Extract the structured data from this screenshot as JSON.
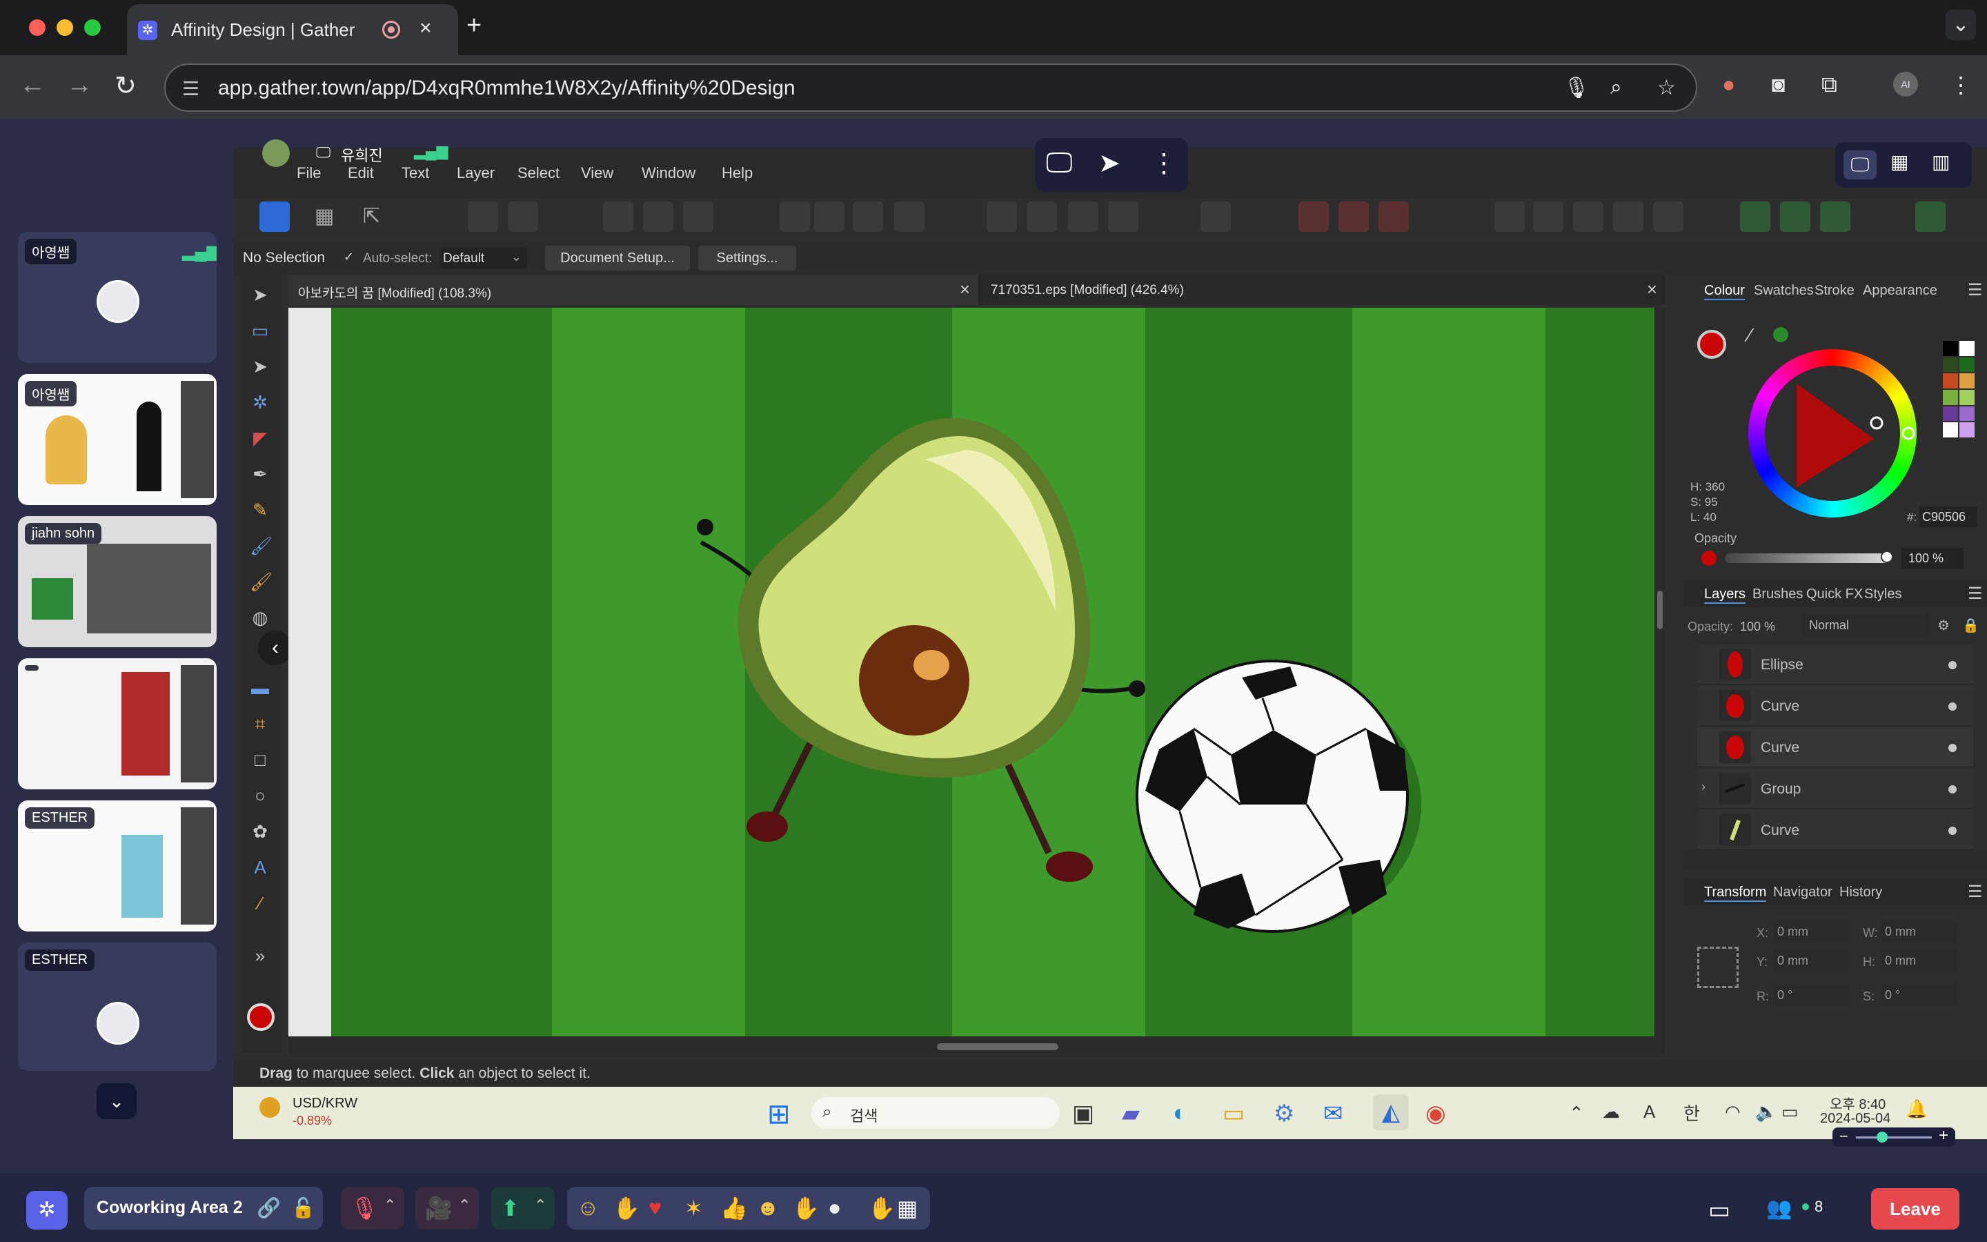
{
  "browser": {
    "tab_title": "Affinity Design | Gather",
    "url": "app.gather.town/app/D4xqR0mmhe1W8X2y/Affinity%20Design"
  },
  "gather": {
    "presenter": "유희진",
    "tiles": [
      {
        "label": "아영쌤"
      },
      {
        "label": "아영쌤"
      },
      {
        "label": "jiahn sohn"
      },
      {
        "label": ""
      },
      {
        "label": "ESTHER"
      },
      {
        "label": "ESTHER"
      }
    ],
    "room_name": "Coworking Area 2",
    "participant_count": "8",
    "leave_label": "Leave"
  },
  "affinity": {
    "menus": [
      "File",
      "Edit",
      "Text",
      "Layer",
      "Select",
      "View",
      "Window",
      "Help"
    ],
    "context": {
      "selection": "No Selection",
      "auto_select": "Auto-select:",
      "auto_select_value": "Default",
      "document_setup": "Document Setup...",
      "settings": "Settings..."
    },
    "doc_tabs": [
      "아보카도의 꿈 [Modified] (108.3%)",
      "7170351.eps [Modified] (426.4%)"
    ],
    "status": {
      "drag": "Drag",
      "mid": " to marquee select. ",
      "click": "Click",
      "end": " an object to select it."
    },
    "colour_tabs": [
      "Colour",
      "Swatches",
      "Stroke",
      "Appearance"
    ],
    "hsl": {
      "h": "H: 360",
      "s": "S: 95",
      "l": "L: 40"
    },
    "hex": "C90506",
    "hex_prefix": "#:",
    "opacity_label": "Opacity",
    "opacity_value": "100 %",
    "layer_tabs": [
      "Layers",
      "Brushes",
      "Quick FX",
      "Styles"
    ],
    "layer_opacity_label": "Opacity:",
    "layer_opacity_value": "100 %",
    "blend_mode": "Normal",
    "layers": [
      "Ellipse",
      "Curve",
      "Curve",
      "Group",
      "Curve"
    ],
    "transform_tabs": [
      "Transform",
      "Navigator",
      "History"
    ],
    "transform": {
      "x": "X:",
      "x_val": "0 mm",
      "w": "W:",
      "w_val": "0 mm",
      "y": "Y:",
      "y_val": "0 mm",
      "h": "H:",
      "h_val": "0 mm",
      "r": "R:",
      "r_val": "0 °",
      "s": "S:",
      "s_val": "0 °"
    },
    "accent_color": "#C90506"
  },
  "windows_taskbar": {
    "ticker": "USD/KRW",
    "ticker_change": "-0.89%",
    "search_placeholder": "검색",
    "ime": "한",
    "time": "오후 8:40",
    "date": "2024-05-04"
  }
}
